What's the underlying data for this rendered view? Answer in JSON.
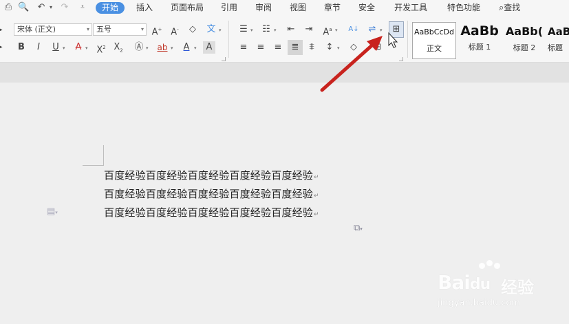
{
  "menu": {
    "tabs": [
      "开始",
      "插入",
      "页面布局",
      "引用",
      "审阅",
      "视图",
      "章节",
      "安全",
      "开发工具",
      "特色功能"
    ],
    "active_tab": "开始",
    "search_label": "查找",
    "accent_color": "#4a90e2"
  },
  "ribbon": {
    "font_name": "宋体 (正文)",
    "font_size": "五号",
    "styles": [
      {
        "sample": "AaBbCcDd",
        "name": "正文"
      },
      {
        "sample": "AaBb",
        "name": "标题 1"
      },
      {
        "sample": "AaBb(",
        "name": "标题 2"
      },
      {
        "sample": "AaB",
        "name": "标题"
      }
    ]
  },
  "document": {
    "lines": [
      "百度经验百度经验百度经验百度经验百度经验",
      "百度经验百度经验百度经验百度经验百度经验",
      "百度经验百度经验百度经验百度经验百度经验"
    ],
    "paragraph_mark": "↵"
  },
  "annotation": {
    "arrow_color": "#c8231e"
  },
  "watermark": {
    "logo": "Bai",
    "logo_du": "du",
    "cn": "经验",
    "url": "jingyan.baidu.com"
  }
}
